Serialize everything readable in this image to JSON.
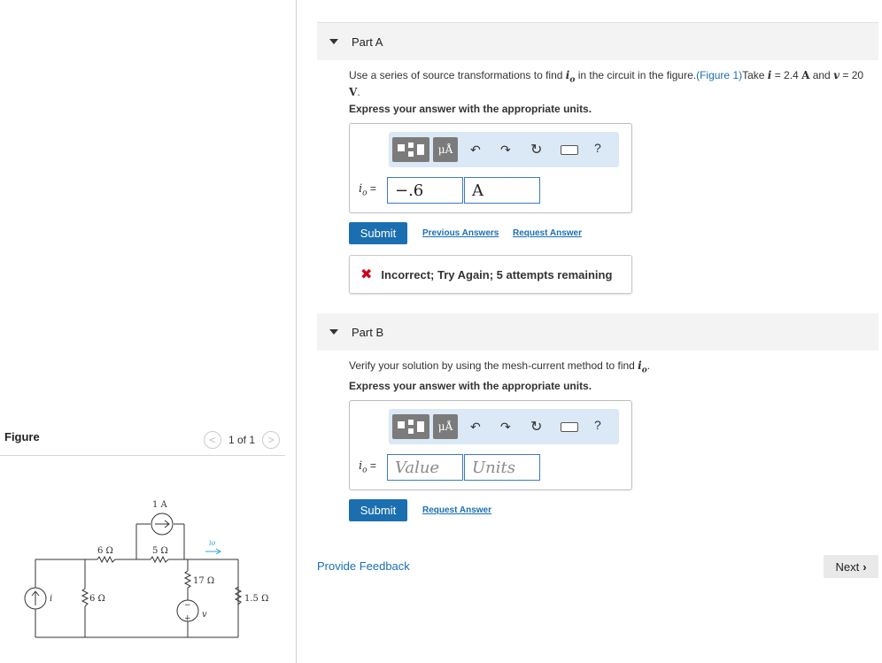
{
  "figure": {
    "title": "Figure",
    "pager": "1 of 1",
    "prev_icon": "chevron-left-icon",
    "next_icon": "chevron-right-icon",
    "circuit": {
      "source_current_label": "i",
      "r_left_series": "6 Ω",
      "r_left_shunt": "6 Ω",
      "current_source_top": "1 A",
      "r_middle_series": "5 Ω",
      "r_middle_shunt": "17 Ω",
      "voltage_source": "v",
      "r_right": "1.5 Ω",
      "output_current": "io",
      "plus": "+",
      "minus": "−"
    }
  },
  "partA": {
    "label": "Part A",
    "question_prefix": "Use a series of source transformations to find ",
    "question_var": "i",
    "question_var_sub": "o",
    "question_mid": " in the circuit in the figure.",
    "figure_link": "(Figure 1)",
    "take": "Take ",
    "i_sym": "i",
    "i_eq": " = 2.4 ",
    "i_unit": "A",
    "and": " and ",
    "v_sym": "v",
    "v_eq": " = 20",
    "v_unit": "V",
    "period": ".",
    "express": "Express your answer with the appropriate units.",
    "answer_label": "i",
    "answer_label_sub": "o",
    "answer_eq": " =",
    "value": "−.6",
    "unit": "A",
    "submit": "Submit",
    "prev_answers": "Previous Answers",
    "request_answer": "Request Answer",
    "feedback": "Incorrect; Try Again; 5 attempts remaining"
  },
  "partB": {
    "label": "Part B",
    "question_prefix": "Verify your solution by using the mesh-current method to find ",
    "question_var": "i",
    "question_var_sub": "o",
    "question_suffix": ".",
    "express": "Express your answer with the appropriate units.",
    "answer_label": "i",
    "answer_label_sub": "o",
    "answer_eq": " =",
    "value_placeholder": "Value",
    "unit_placeholder": "Units",
    "submit": "Submit",
    "request_answer": "Request Answer"
  },
  "toolbar": {
    "templates_icon": "templates-icon",
    "units_glyph": "μÅ",
    "undo_icon": "undo-icon",
    "redo_icon": "redo-icon",
    "reset_icon": "reset-icon",
    "keyboard_icon": "keyboard-icon",
    "help": "?"
  },
  "footer": {
    "provide_feedback": "Provide Feedback",
    "next": "Next"
  },
  "colors": {
    "link": "#1a6fb3",
    "submit": "#1b6fb0",
    "toolbar_bg": "#dbe8f5",
    "error": "#d0021b"
  }
}
